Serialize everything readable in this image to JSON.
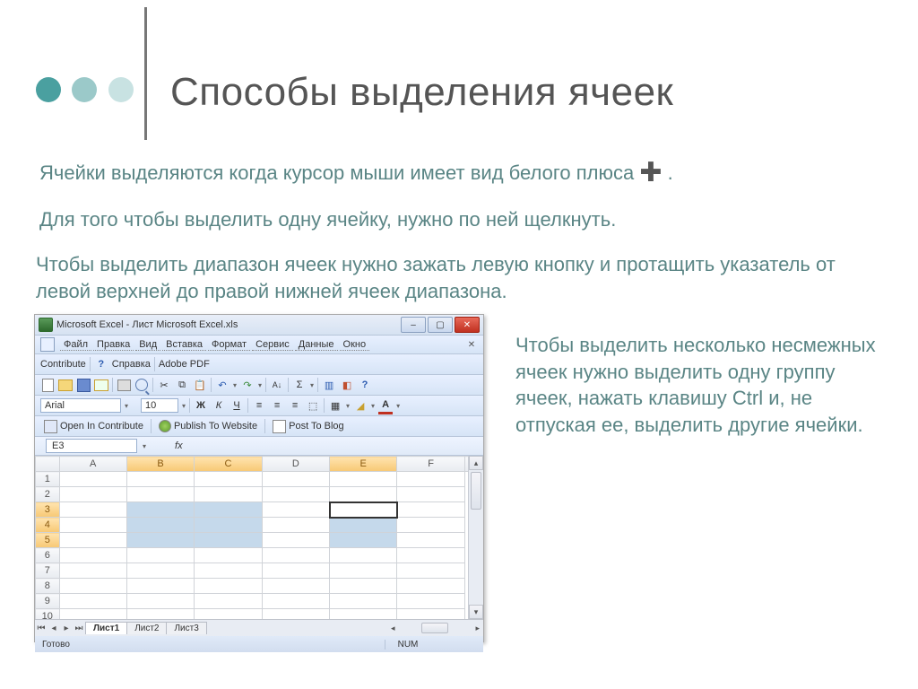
{
  "title": "Способы выделения ячеек",
  "para1_a": "Ячейки выделяются когда курсор мыши имеет вид белого плюса ",
  "para1_b": ".",
  "para2": "Для того чтобы выделить одну ячейку, нужно по ней щелкнуть.",
  "para3": "Чтобы выделить диапазон ячеек нужно зажать левую кнопку и протащить указатель от левой верхней до правой нижней ячеек диапазона.",
  "sidepara": "Чтобы выделить несколько несмежных ячеек нужно выделить одну группу ячеек, нажать клавишу Ctrl и, не отпуская ее, выделить другие ячейки.",
  "excel": {
    "title": "Microsoft Excel - Лист Microsoft Excel.xls",
    "menu": [
      "Файл",
      "Правка",
      "Вид",
      "Вставка",
      "Формат",
      "Сервис",
      "Данные",
      "Окно"
    ],
    "toolbar2": {
      "contribute": "Contribute",
      "help": "Справка",
      "adobe": "Adobe PDF"
    },
    "font": {
      "name": "Arial",
      "size": "10",
      "bold": "Ж",
      "italic": "К",
      "underline": "Ч"
    },
    "ct": {
      "open": "Open In Contribute",
      "publish": "Publish To Website",
      "post": "Post To Blog"
    },
    "namebox": "E3",
    "fx": "fx",
    "cols": [
      "A",
      "B",
      "C",
      "D",
      "E",
      "F"
    ],
    "active_col_idx": [
      1,
      2,
      4
    ],
    "rows": [
      "1",
      "2",
      "3",
      "4",
      "5",
      "6",
      "7",
      "8",
      "9",
      "10"
    ],
    "active_row_idx": [
      2,
      3,
      4
    ],
    "selected_cells": [
      "B3",
      "B4",
      "B5",
      "C3",
      "C4",
      "C5",
      "E4",
      "E5"
    ],
    "active_cell": "E3",
    "tabs": [
      "Лист1",
      "Лист2",
      "Лист3"
    ],
    "active_tab": 0,
    "status": {
      "ready": "Готово",
      "num": "NUM"
    }
  }
}
